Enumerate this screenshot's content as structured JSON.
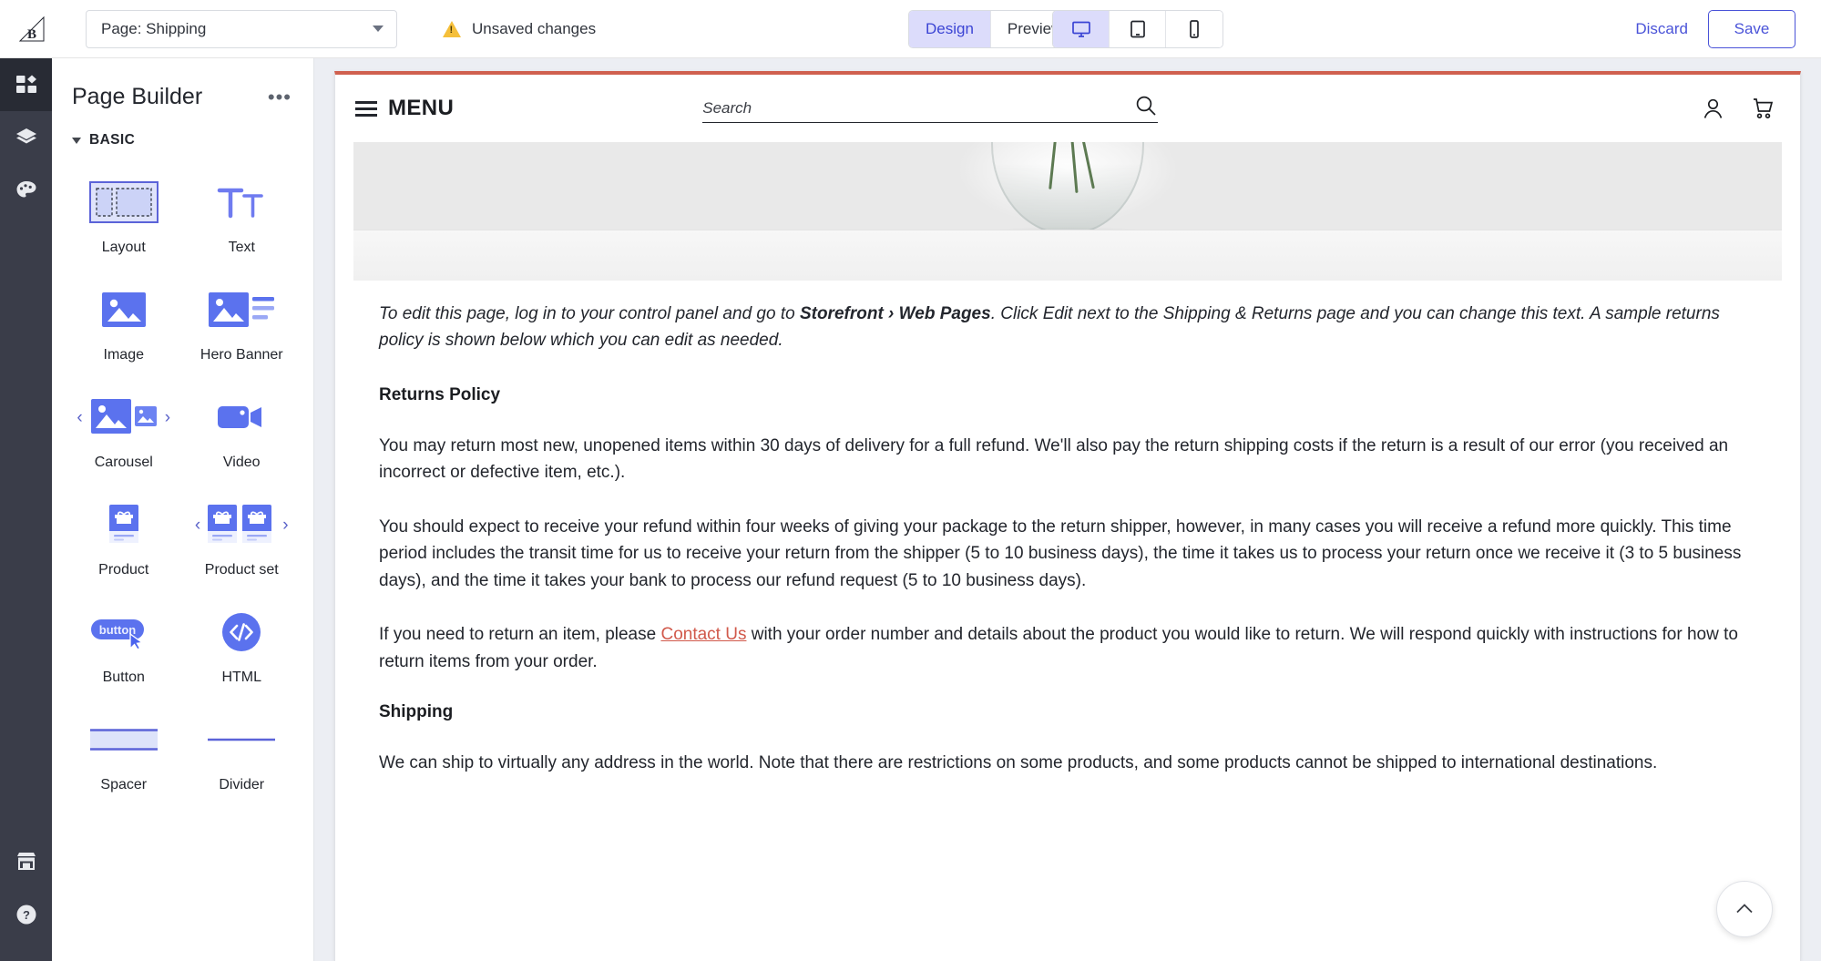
{
  "topbar": {
    "brand_icon": "bigcommerce-logo-icon",
    "page_select_value": "Page: Shipping",
    "unsaved_label": "Unsaved changes",
    "warning_icon": "warning-triangle-icon",
    "mode_tabs": [
      {
        "label": "Design",
        "active": true
      },
      {
        "label": "Preview",
        "active": false
      }
    ],
    "devices": [
      {
        "name": "desktop-view-icon",
        "active": true
      },
      {
        "name": "tablet-view-icon",
        "active": false
      },
      {
        "name": "mobile-view-icon",
        "active": false
      }
    ],
    "discard_label": "Discard",
    "save_label": "Save"
  },
  "rail": {
    "items": [
      {
        "icon": "blocks-icon",
        "active": true
      },
      {
        "icon": "layers-icon",
        "active": false
      },
      {
        "icon": "palette-icon",
        "active": false
      }
    ],
    "bottom_items": [
      {
        "icon": "storefront-icon"
      },
      {
        "icon": "help-icon"
      }
    ]
  },
  "panel": {
    "title": "Page Builder",
    "more_label": "•••",
    "section_label": "BASIC",
    "widgets": [
      {
        "label": "Layout",
        "icon": "layout-widget-icon",
        "arrows": false
      },
      {
        "label": "Text",
        "icon": "text-widget-icon",
        "arrows": false
      },
      {
        "label": "Image",
        "icon": "image-widget-icon",
        "arrows": false
      },
      {
        "label": "Hero Banner",
        "icon": "hero-banner-widget-icon",
        "arrows": false
      },
      {
        "label": "Carousel",
        "icon": "carousel-widget-icon",
        "arrows": true
      },
      {
        "label": "Video",
        "icon": "video-widget-icon",
        "arrows": false
      },
      {
        "label": "Product",
        "icon": "product-widget-icon",
        "arrows": false
      },
      {
        "label": "Product set",
        "icon": "product-set-widget-icon",
        "arrows": true
      },
      {
        "label": "Button",
        "icon": "button-widget-icon",
        "arrows": false
      },
      {
        "label": "HTML",
        "icon": "html-widget-icon",
        "arrows": false
      },
      {
        "label": "Spacer",
        "icon": "spacer-widget-icon",
        "arrows": false
      },
      {
        "label": "Divider",
        "icon": "divider-widget-icon",
        "arrows": false
      }
    ]
  },
  "canvas": {
    "accent_bar_color": "#d0604f",
    "store_header": {
      "menu_label": "MENU",
      "menu_icon": "hamburger-icon",
      "search_placeholder": "Search",
      "search_value": "",
      "search_icon": "search-icon",
      "account_icon": "user-account-icon",
      "cart_icon": "shopping-cart-icon"
    },
    "hero_image_alt": "glass-vase-photo",
    "intro": {
      "part1": "To edit this page, log in to your control panel and go to ",
      "bold": "Storefront › Web Pages",
      "part2": ". Click Edit next to the Shipping & Returns page and you can change this text. A sample returns policy is shown below which you can edit as needed."
    },
    "returns_heading": "Returns Policy",
    "returns_p1": "You may return most new, unopened items within 30 days of delivery for a full refund. We'll also pay the return shipping costs if the return is a result of our error (you received an incorrect or defective item, etc.).",
    "returns_p2": "You should expect to receive your refund within four weeks of giving your package to the return shipper, however, in many cases you will receive a refund more quickly. This time period includes the transit time for us to receive your return from the shipper (5 to 10 business days), the time it takes us to process your return once we receive it (3 to 5 business days), and the time it takes your bank to process our refund request (5 to 10 business days).",
    "returns_p3_before": "If you need to return an item, please ",
    "returns_p3_link": "Contact Us",
    "returns_p3_after": " with your order number and details about the product you would like to return. We will respond quickly with instructions for how to return items from your order.",
    "shipping_heading": "Shipping",
    "shipping_p1": "We can ship to virtually any address in the world. Note that there are restrictions on some products, and some products cannot be shipped to international destinations.",
    "back_to_top_icon": "chevron-up-icon"
  },
  "colors": {
    "accent_blue": "#4a53d8",
    "active_tab_bg": "#dcdcfb",
    "rail_bg": "#3a3d49",
    "canvas_bar": "#d0604f",
    "link_red": "#d1594b",
    "warning_yellow": "#f5bf3a"
  }
}
